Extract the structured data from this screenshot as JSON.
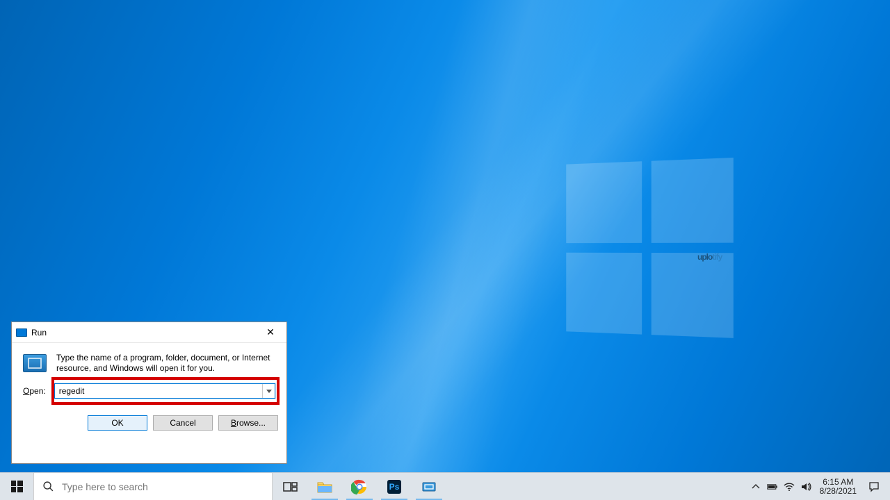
{
  "watermark": {
    "bold": "uplo",
    "faded": "tify"
  },
  "run_dialog": {
    "title": "Run",
    "description": "Type the name of a program, folder, document, or Internet resource, and Windows will open it for you.",
    "open_label": "Open:",
    "open_value": "regedit",
    "buttons": {
      "ok": "OK",
      "cancel": "Cancel",
      "browse": "Browse..."
    }
  },
  "taskbar": {
    "search_placeholder": "Type here to search",
    "clock": {
      "time": "6:15 AM",
      "date": "8/28/2021"
    },
    "task_items": [
      {
        "name": "task-view",
        "running": false
      },
      {
        "name": "file-explorer",
        "running": true
      },
      {
        "name": "google-chrome",
        "running": true
      },
      {
        "name": "photoshop",
        "running": true
      },
      {
        "name": "run-dialog-task",
        "running": true
      }
    ]
  }
}
